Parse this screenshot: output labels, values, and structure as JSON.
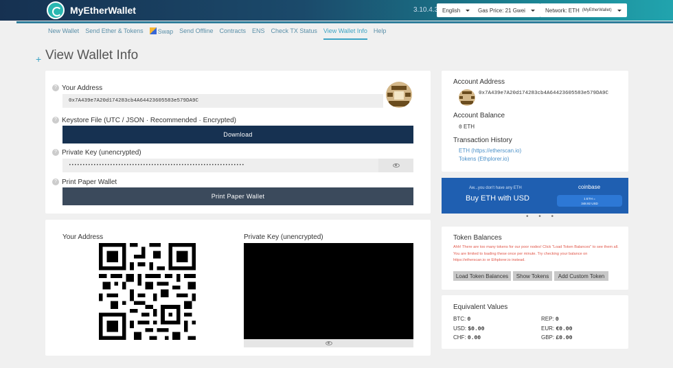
{
  "header": {
    "brand": "MyEtherWallet",
    "version": "3.10.4.3",
    "language": "English",
    "gas_price": "Gas Price: 21 Gwei",
    "network": "Network: ETH",
    "network_sub": "(MyEtherWallet)"
  },
  "nav": {
    "items": [
      "New Wallet",
      "Send Ether & Tokens",
      "Swap",
      "Send Offline",
      "Contracts",
      "ENS",
      "Check TX Status",
      "View Wallet Info",
      "Help"
    ],
    "active": "View Wallet Info"
  },
  "page": {
    "plus": "+",
    "title": "View Wallet Info"
  },
  "wallet": {
    "your_address_label": "Your Address",
    "address": "0x7A439e7A20d174283cb4A64423605583e579DA9C",
    "keystore_label": "Keystore File (UTC / JSON · Recommended · Encrypted)",
    "download_label": "Download",
    "private_key_label": "Private Key (unencrypted)",
    "private_key_masked": "••••••••••••••••••••••••••••••••••••••••••••••••••••••••••••••••",
    "paper_label": "Print Paper Wallet",
    "paper_button": "Print Paper Wallet",
    "qmark": "?"
  },
  "qr_section": {
    "address_label": "Your Address",
    "private_key_label": "Private Key (unencrypted)"
  },
  "account": {
    "address_label": "Account Address",
    "address": "0x7A439e7A20d174283cb4A64423605583e579DA9C",
    "balance_label": "Account Balance",
    "balance_value": "0",
    "balance_unit": "ETH",
    "history_label": "Transaction History",
    "history_eth": "ETH (https://etherscan.io)",
    "history_tokens": "Tokens (Ethplorer.io)"
  },
  "coinbase": {
    "note": "Aw...you don't have any ETH",
    "cta": "Buy ETH with USD",
    "brand": "coinbase",
    "rate_line1": "1 ETH =",
    "rate_line2": "348.92 USD",
    "dots": "• • •"
  },
  "tokens": {
    "title": "Token Balances",
    "warning": "Ahh! There are too many tokens for our poor nodes! Click \"Load Token Balances\" to see them all. You are limited to loading these once per minute. Try checking your balance on https://etherscan.io or Ethplorer.io instead.",
    "buttons": [
      "Load Token Balances",
      "Show Tokens",
      "Add Custom Token"
    ]
  },
  "equivalent": {
    "title": "Equivalent Values",
    "left": [
      {
        "label": "BTC:",
        "value": "0"
      },
      {
        "label": "USD:",
        "value": "$0.00"
      },
      {
        "label": "CHF:",
        "value": "0.00"
      }
    ],
    "right": [
      {
        "label": "REP:",
        "value": "0"
      },
      {
        "label": "EUR:",
        "value": "€0.00"
      },
      {
        "label": "GBP:",
        "value": "£0.00"
      }
    ]
  },
  "colors": {
    "header_start": "#163151",
    "header_end": "#21a4ae",
    "accent": "#3ca3c4",
    "download_button": "#163151",
    "print_button": "#3b4a5c",
    "coinbase_bg": "#1f5fb1",
    "warning_text": "#e0574a"
  }
}
